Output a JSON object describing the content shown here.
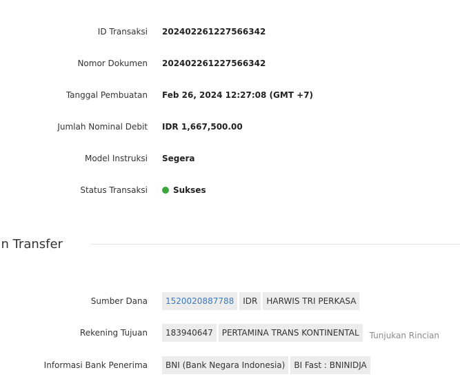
{
  "transaction": {
    "id_label": "ID Transaksi",
    "id_value": "202402261227566342",
    "doc_label": "Nomor Dokumen",
    "doc_value": "202402261227566342",
    "created_label": "Tanggal Pembuatan",
    "created_value": "Feb 26, 2024 12:27:08 (GMT +7)",
    "debit_label": "Jumlah Nominal Debit",
    "debit_value": "IDR 1,667,500.00",
    "model_label": "Model Instruksi",
    "model_value": "Segera",
    "status_label": "Status Transaksi",
    "status_value": "Sukses",
    "status_color": "#3aa53a"
  },
  "section": {
    "title": "asan Transfer"
  },
  "transfer": {
    "source_label": "Sumber Dana",
    "source_account": "1520020887788",
    "source_currency": "IDR",
    "source_name": "HARWIS TRI PERKASA",
    "dest_label": "Rekening Tujuan",
    "dest_account": "183940647",
    "dest_name": "PERTAMINA TRANS KONTINENTAL",
    "dest_detail_link": "Tunjukan Rincian",
    "bank_label": "Informasi Bank Penerima",
    "bank_name": "BNI (Bank Negara Indonesia)",
    "bank_code": "BI Fast : BNINIDJA"
  }
}
